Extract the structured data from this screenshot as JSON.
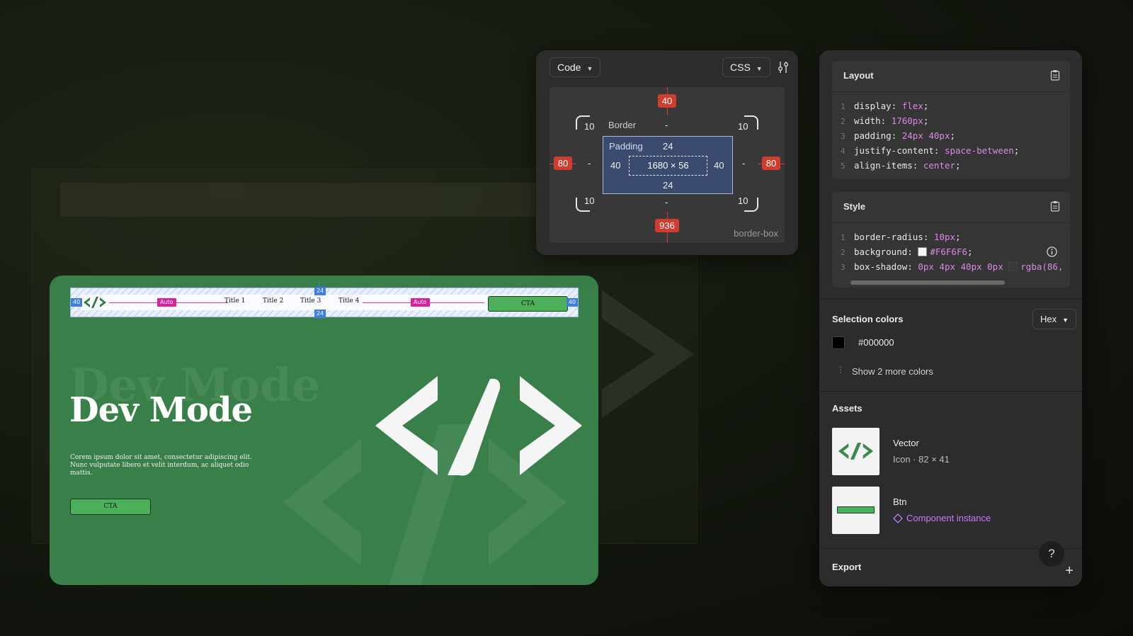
{
  "code_panel": {
    "mode_dropdown": "Code",
    "lang_dropdown": "CSS",
    "box_model": {
      "margin_top": "40",
      "margin_right": "80",
      "margin_bottom": "936",
      "margin_left": "80",
      "border_label": "Border",
      "border_top": "-",
      "border_right": "-",
      "border_bottom": "-",
      "border_left": "-",
      "radius_tl": "10",
      "radius_tr": "10",
      "radius_bl": "10",
      "radius_br": "10",
      "padding_label": "Padding",
      "padding_top": "24",
      "padding_right": "40",
      "padding_bottom": "24",
      "padding_left": "40",
      "content_size": "1680 × 56",
      "box_sizing": "border-box"
    }
  },
  "inspect_panel": {
    "layout": {
      "title": "Layout",
      "lines": [
        {
          "n": "1",
          "prop": "display",
          "val": "flex"
        },
        {
          "n": "2",
          "prop": "width",
          "val": "1760px"
        },
        {
          "n": "3",
          "prop": "padding",
          "val": "24px 40px"
        },
        {
          "n": "4",
          "prop": "justify-content",
          "val": "space-between"
        },
        {
          "n": "5",
          "prop": "align-items",
          "val": "center"
        }
      ]
    },
    "style": {
      "title": "Style",
      "lines": [
        {
          "n": "1",
          "prop": "border-radius",
          "val": "10px"
        },
        {
          "n": "2",
          "prop": "background",
          "val": "#F6F6F6"
        },
        {
          "n": "3",
          "prop": "box-shadow",
          "val": "0px 4px 40px 0px",
          "val2": "rgba(86,"
        }
      ]
    },
    "selection_colors": {
      "title": "Selection colors",
      "format": "Hex",
      "color": "#000000",
      "more": "Show 2 more colors"
    },
    "assets": {
      "title": "Assets",
      "items": [
        {
          "name": "Vector",
          "sub": "Icon · 82 × 41"
        },
        {
          "name": "Btn",
          "sub": "Component instance"
        }
      ]
    },
    "export": {
      "title": "Export"
    },
    "help": "?"
  },
  "preview": {
    "nav": {
      "padding_left_tag": "40",
      "padding_right_tag": "40",
      "gap_top_tag": "24",
      "gap_bottom_tag": "24",
      "auto_left": "Auto",
      "auto_right": "Auto",
      "titles": [
        "Title 1",
        "Title 2",
        "Title 3",
        "Title 4"
      ],
      "cta": "CTA"
    },
    "ghost_title": "Dev Mode",
    "title": "Dev Mode",
    "body": "Corem ipsum dolor sit amet, consectetur adipiscing elit. Nunc vulputate libero et velit interdum, ac aliquet odio mattis.",
    "cta": "CTA"
  },
  "colors": {
    "accent_green": "#387f49",
    "button_green": "#4caf5a",
    "margin_red": "#d23c2f",
    "padding_blue": "#3b4b70",
    "code_value": "#d98ae3",
    "auto_pink": "#d9219d"
  }
}
